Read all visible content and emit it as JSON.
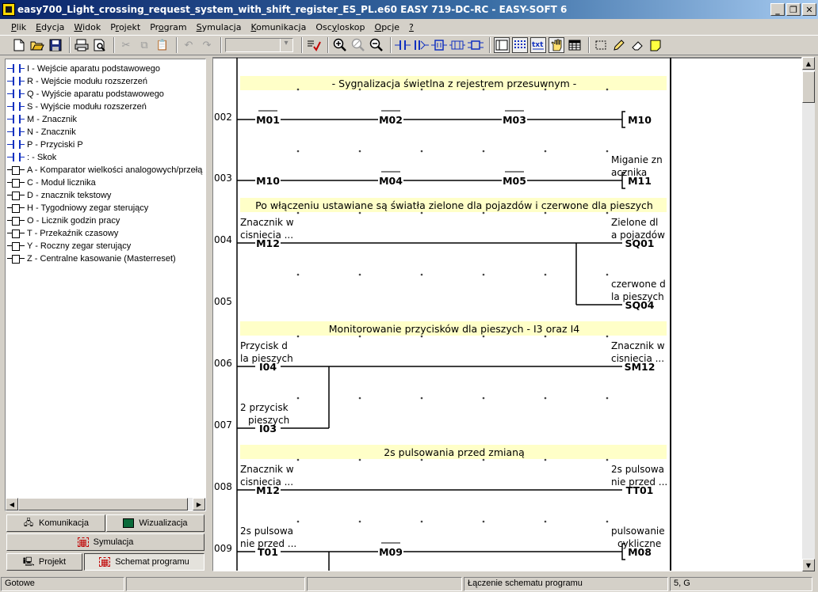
{
  "title": "easy700_Light_crossing_request_system_with_shift_register_ES_PL.e60 EASY 719-DC-RC - EASY-SOFT 6",
  "window_buttons": {
    "minimize": "_",
    "restore": "❐",
    "close": "✕"
  },
  "menu": [
    {
      "label": "Plik",
      "key": "P"
    },
    {
      "label": "Edycja",
      "key": "E"
    },
    {
      "label": "Widok",
      "key": "W"
    },
    {
      "label": "Projekt",
      "key": "r"
    },
    {
      "label": "Program",
      "key": "o"
    },
    {
      "label": "Symulacja",
      "key": "S"
    },
    {
      "label": "Komunikacja",
      "key": "K"
    },
    {
      "label": "Oscyloskop",
      "key": "y"
    },
    {
      "label": "Opcje",
      "key": "O"
    },
    {
      "label": "?",
      "key": "?"
    }
  ],
  "toolbar": {
    "icons": [
      "new-icon",
      "open-icon",
      "save-icon",
      "print-icon",
      "print-preview-icon",
      "cut-icon",
      "copy-icon",
      "paste-icon",
      "undo-icon",
      "redo-icon"
    ],
    "zoom_combo_value": "",
    "icons2": [
      "check-program-icon",
      "zoom-in-icon",
      "zoom-reset-icon",
      "zoom-out-icon",
      "contact-icon",
      "coil-connect-icon",
      "function-block-icon",
      "wire-icon",
      "relay-icon",
      "view-icon",
      "grid-icon",
      "text-icon",
      "hand-icon",
      "table-icon",
      "select-icon",
      "pencil-icon",
      "eraser-icon",
      "note-icon"
    ]
  },
  "tree": [
    {
      "icon": "contact",
      "label": "I - Wejście aparatu podstawowego"
    },
    {
      "icon": "contact",
      "label": "R - Wejście modułu rozszerzeń"
    },
    {
      "icon": "contact",
      "label": "Q - Wyjście aparatu podstawowego"
    },
    {
      "icon": "contact",
      "label": "S - Wyjście modułu rozszerzeń"
    },
    {
      "icon": "contact",
      "label": "M - Znacznik"
    },
    {
      "icon": "contact",
      "label": "N - Znacznik"
    },
    {
      "icon": "contact",
      "label": "P - Przyciski P"
    },
    {
      "icon": "contact",
      "label": ": - Skok"
    },
    {
      "icon": "coil",
      "label": "A - Komparator wielkości analogowych/przełą"
    },
    {
      "icon": "coil",
      "label": "C - Moduł licznika"
    },
    {
      "icon": "coil",
      "label": "D - znacznik tekstowy"
    },
    {
      "icon": "coil",
      "label": "H - Tygodniowy zegar sterujący"
    },
    {
      "icon": "coil",
      "label": "O - Licznik godzin pracy"
    },
    {
      "icon": "coil",
      "label": "T - Przekaźnik czasowy"
    },
    {
      "icon": "coil",
      "label": "Y - Roczny zegar sterujący"
    },
    {
      "icon": "coil",
      "label": "Z - Centralne kasowanie (Masterreset)"
    }
  ],
  "panel_buttons": {
    "komunikacja": "Komunikacja",
    "wizualizacja": "Wizualizacja",
    "symulacja": "Symulacja",
    "projekt": "Projekt",
    "schemat": "Schemat programu"
  },
  "diagram": {
    "comments": [
      {
        "text": "- Sygnalizacja świetlna z rejestrem przesuwnym -"
      },
      {
        "text": "Po włączeniu ustawiane są światła zielone dla pojazdów i czerwone dla pieszych"
      },
      {
        "text": "Monitorowanie przycisków dla pieszych - I3 oraz I4"
      },
      {
        "text": "2s pulsowania przed zmianą"
      }
    ],
    "row_numbers": [
      "002",
      "003",
      "004",
      "005",
      "006",
      "007",
      "008",
      "009"
    ],
    "contacts": [
      {
        "label": "M01",
        "negated": true
      },
      {
        "label": "M02",
        "negated": true
      },
      {
        "label": "M03",
        "negated": true
      },
      {
        "label": "M10",
        "negated": false
      },
      {
        "label": "M04",
        "negated": true
      },
      {
        "label": "M05",
        "negated": true
      },
      {
        "label": "M12",
        "negated": false
      },
      {
        "label": "I04",
        "negated": false
      },
      {
        "label": "I03",
        "negated": false
      },
      {
        "label": "M12",
        "negated": false
      },
      {
        "label": "T01",
        "negated": false
      },
      {
        "label": "M09",
        "negated": true
      }
    ],
    "coils": [
      {
        "label": "M10",
        "bracket": true
      },
      {
        "label": "M11",
        "bracket": true
      },
      {
        "label": "SQ01",
        "bracket": false
      },
      {
        "label": "SQ04",
        "bracket": false
      },
      {
        "label": "SM12",
        "bracket": false
      },
      {
        "label": "TT01",
        "bracket": false
      },
      {
        "label": "M08",
        "bracket": true
      }
    ],
    "annotations": [
      {
        "lines": [
          "Miganie zn",
          "acznika"
        ]
      },
      {
        "lines": [
          "Znacznik w",
          "cisniecia ..."
        ]
      },
      {
        "lines": [
          "Zielone dl",
          "a pojazdów"
        ]
      },
      {
        "lines": [
          "czerwone d",
          "la pieszych"
        ]
      },
      {
        "lines": [
          "Przycisk d",
          "la pieszych"
        ]
      },
      {
        "lines": [
          "Znacznik w",
          "cisniecia ..."
        ]
      },
      {
        "lines": [
          "2 przycisk",
          "pieszych"
        ]
      },
      {
        "lines": [
          "Znacznik w",
          "cisniecia ..."
        ]
      },
      {
        "lines": [
          "2s pulsowa",
          "nie przed ..."
        ]
      },
      {
        "lines": [
          "2s pulsowa",
          "nie przed ..."
        ]
      },
      {
        "lines": [
          "pulsowanie",
          "cykliczne"
        ]
      }
    ]
  },
  "status": {
    "left": "Gotowe",
    "empty1": "",
    "empty2": "",
    "message": "Łączenie schematu programu",
    "position": "5, G"
  }
}
